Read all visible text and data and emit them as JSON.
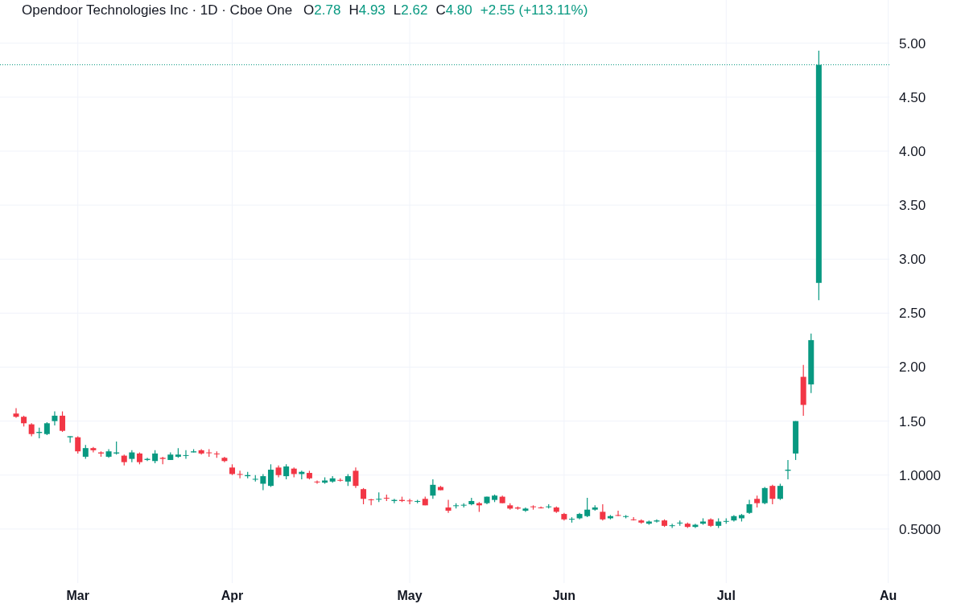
{
  "header": {
    "title": "Opendoor Technologies Inc · 1D · Cboe One",
    "ohlc": [
      {
        "label": "O",
        "value": "2.78"
      },
      {
        "label": "H",
        "value": "4.93"
      },
      {
        "label": "L",
        "value": "2.62"
      },
      {
        "label": "C",
        "value": "4.80"
      }
    ],
    "change": "+2.55 (+113.11%)"
  },
  "chart_data": {
    "type": "candlestick",
    "grid": true,
    "ref_lines": [
      {
        "axis": "y",
        "value": 4.8,
        "color": "#089981"
      }
    ],
    "ylim": [
      0,
      5.4
    ],
    "yticks": [
      {
        "value": 0.5,
        "label": "0.5000"
      },
      {
        "value": 1,
        "label": "1.0000"
      },
      {
        "value": 1.5,
        "label": "1.50"
      },
      {
        "value": 2,
        "label": "2.00"
      },
      {
        "value": 2.5,
        "label": "2.50"
      },
      {
        "value": 3,
        "label": "3.00"
      },
      {
        "value": 3.5,
        "label": "3.50"
      },
      {
        "value": 4,
        "label": "4.00"
      },
      {
        "value": 4.5,
        "label": "4.50"
      },
      {
        "value": 5,
        "label": "5.00"
      }
    ],
    "categories": [
      null,
      null,
      null,
      null,
      null,
      null,
      null,
      null,
      "Mar",
      null,
      null,
      null,
      null,
      null,
      null,
      null,
      null,
      null,
      null,
      null,
      null,
      null,
      null,
      null,
      null,
      null,
      null,
      null,
      "Apr",
      null,
      null,
      null,
      null,
      null,
      null,
      null,
      null,
      null,
      null,
      null,
      null,
      null,
      null,
      null,
      null,
      null,
      null,
      null,
      null,
      null,
      null,
      "May",
      null,
      null,
      null,
      null,
      null,
      null,
      null,
      null,
      null,
      null,
      null,
      null,
      null,
      null,
      null,
      null,
      null,
      null,
      null,
      "Jun",
      null,
      null,
      null,
      null,
      null,
      null,
      null,
      null,
      null,
      null,
      null,
      null,
      null,
      null,
      null,
      null,
      null,
      null,
      null,
      null,
      "Jul",
      null,
      null,
      null,
      null,
      null,
      null,
      null,
      null,
      null,
      null,
      null,
      null,
      null,
      null,
      null,
      null,
      null,
      null,
      null,
      null,
      "Au"
    ],
    "ohlc": [
      [
        1.57,
        1.62,
        1.53,
        1.54
      ],
      [
        1.54,
        1.55,
        1.45,
        1.48
      ],
      [
        1.47,
        1.48,
        1.36,
        1.38
      ],
      [
        1.39,
        1.44,
        1.34,
        1.4
      ],
      [
        1.38,
        1.49,
        1.37,
        1.48
      ],
      [
        1.5,
        1.59,
        1.46,
        1.55
      ],
      [
        1.55,
        1.59,
        1.4,
        1.41
      ],
      [
        1.35,
        1.36,
        1.3,
        1.36
      ],
      [
        1.35,
        1.36,
        1.2,
        1.22
      ],
      [
        1.17,
        1.28,
        1.15,
        1.25
      ],
      [
        1.25,
        1.26,
        1.21,
        1.23
      ],
      [
        1.21,
        1.22,
        1.17,
        1.2
      ],
      [
        1.17,
        1.24,
        1.16,
        1.22
      ],
      [
        1.2,
        1.31,
        1.19,
        1.21
      ],
      [
        1.18,
        1.19,
        1.09,
        1.12
      ],
      [
        1.15,
        1.23,
        1.12,
        1.21
      ],
      [
        1.2,
        1.21,
        1.1,
        1.12
      ],
      [
        1.14,
        1.16,
        1.13,
        1.15
      ],
      [
        1.13,
        1.23,
        1.11,
        1.2
      ],
      [
        1.16,
        1.17,
        1.1,
        1.15
      ],
      [
        1.14,
        1.21,
        1.14,
        1.19
      ],
      [
        1.17,
        1.25,
        1.16,
        1.19
      ],
      [
        1.18,
        1.23,
        1.15,
        1.185
      ],
      [
        1.21,
        1.24,
        1.21,
        1.22
      ],
      [
        1.23,
        1.24,
        1.19,
        1.2
      ],
      [
        1.21,
        1.24,
        1.17,
        1.205
      ],
      [
        1.2,
        1.22,
        1.16,
        1.195
      ],
      [
        1.16,
        1.17,
        1.12,
        1.13
      ],
      [
        1.07,
        1.1,
        1.0,
        1.01
      ],
      [
        1.01,
        1.04,
        0.97,
        1.005
      ],
      [
        0.99,
        1.03,
        0.97,
        1.0
      ],
      [
        0.96,
        1.0,
        0.94,
        0.965
      ],
      [
        0.92,
        1.01,
        0.86,
        0.99
      ],
      [
        0.9,
        1.1,
        0.89,
        1.05
      ],
      [
        1.07,
        1.09,
        0.98,
        1.0
      ],
      [
        0.99,
        1.1,
        0.96,
        1.08
      ],
      [
        1.06,
        1.07,
        0.98,
        1.01
      ],
      [
        1.01,
        1.04,
        0.96,
        1.03
      ],
      [
        1.02,
        1.04,
        0.96,
        0.97
      ],
      [
        0.94,
        0.95,
        0.92,
        0.935
      ],
      [
        0.93,
        0.98,
        0.92,
        0.95
      ],
      [
        0.94,
        0.99,
        0.93,
        0.97
      ],
      [
        0.955,
        0.97,
        0.94,
        0.95
      ],
      [
        0.94,
        1.01,
        0.9,
        0.99
      ],
      [
        1.04,
        1.07,
        0.88,
        0.9
      ],
      [
        0.87,
        0.88,
        0.73,
        0.78
      ],
      [
        0.775,
        0.78,
        0.72,
        0.77
      ],
      [
        0.775,
        0.84,
        0.75,
        0.78
      ],
      [
        0.79,
        0.82,
        0.76,
        0.785
      ],
      [
        0.76,
        0.78,
        0.74,
        0.77
      ],
      [
        0.77,
        0.8,
        0.75,
        0.76
      ],
      [
        0.765,
        0.78,
        0.73,
        0.76
      ],
      [
        0.755,
        0.77,
        0.74,
        0.76
      ],
      [
        0.78,
        0.8,
        0.72,
        0.72
      ],
      [
        0.81,
        0.96,
        0.78,
        0.91
      ],
      [
        0.89,
        0.9,
        0.86,
        0.86
      ],
      [
        0.7,
        0.77,
        0.65,
        0.67
      ],
      [
        0.715,
        0.74,
        0.69,
        0.72
      ],
      [
        0.72,
        0.74,
        0.7,
        0.725
      ],
      [
        0.73,
        0.79,
        0.72,
        0.76
      ],
      [
        0.74,
        0.75,
        0.66,
        0.72
      ],
      [
        0.74,
        0.8,
        0.73,
        0.8
      ],
      [
        0.77,
        0.82,
        0.75,
        0.81
      ],
      [
        0.8,
        0.81,
        0.74,
        0.74
      ],
      [
        0.72,
        0.74,
        0.68,
        0.69
      ],
      [
        0.7,
        0.71,
        0.68,
        0.69
      ],
      [
        0.67,
        0.7,
        0.66,
        0.69
      ],
      [
        0.71,
        0.72,
        0.68,
        0.705
      ],
      [
        0.7,
        0.71,
        0.69,
        0.695
      ],
      [
        0.705,
        0.73,
        0.69,
        0.71
      ],
      [
        0.7,
        0.71,
        0.65,
        0.66
      ],
      [
        0.64,
        0.65,
        0.58,
        0.59
      ],
      [
        0.59,
        0.61,
        0.56,
        0.595
      ],
      [
        0.6,
        0.65,
        0.59,
        0.64
      ],
      [
        0.62,
        0.79,
        0.61,
        0.68
      ],
      [
        0.68,
        0.72,
        0.67,
        0.7
      ],
      [
        0.66,
        0.73,
        0.58,
        0.59
      ],
      [
        0.6,
        0.63,
        0.59,
        0.62
      ],
      [
        0.63,
        0.67,
        0.62,
        0.625
      ],
      [
        0.615,
        0.63,
        0.6,
        0.62
      ],
      [
        0.59,
        0.61,
        0.58,
        0.585
      ],
      [
        0.58,
        0.59,
        0.55,
        0.56
      ],
      [
        0.55,
        0.58,
        0.54,
        0.57
      ],
      [
        0.57,
        0.59,
        0.56,
        0.58
      ],
      [
        0.58,
        0.59,
        0.52,
        0.53
      ],
      [
        0.53,
        0.55,
        0.51,
        0.535
      ],
      [
        0.555,
        0.58,
        0.53,
        0.56
      ],
      [
        0.55,
        0.56,
        0.51,
        0.52
      ],
      [
        0.52,
        0.55,
        0.51,
        0.54
      ],
      [
        0.55,
        0.6,
        0.54,
        0.57
      ],
      [
        0.59,
        0.6,
        0.52,
        0.53
      ],
      [
        0.53,
        0.6,
        0.51,
        0.57
      ],
      [
        0.57,
        0.6,
        0.55,
        0.575
      ],
      [
        0.58,
        0.63,
        0.57,
        0.62
      ],
      [
        0.6,
        0.64,
        0.57,
        0.63
      ],
      [
        0.65,
        0.77,
        0.64,
        0.73
      ],
      [
        0.78,
        0.81,
        0.7,
        0.74
      ],
      [
        0.74,
        0.89,
        0.73,
        0.88
      ],
      [
        0.9,
        0.91,
        0.73,
        0.78
      ],
      [
        0.78,
        0.92,
        0.77,
        0.9
      ],
      [
        1.04,
        1.14,
        0.96,
        1.05
      ],
      [
        1.2,
        1.5,
        1.14,
        1.5
      ],
      [
        1.91,
        2.02,
        1.55,
        1.65
      ],
      [
        1.84,
        2.31,
        1.76,
        2.25
      ],
      [
        2.78,
        4.93,
        2.62,
        4.8
      ],
      null,
      null,
      null,
      null,
      null,
      null,
      null,
      null,
      null
    ]
  }
}
